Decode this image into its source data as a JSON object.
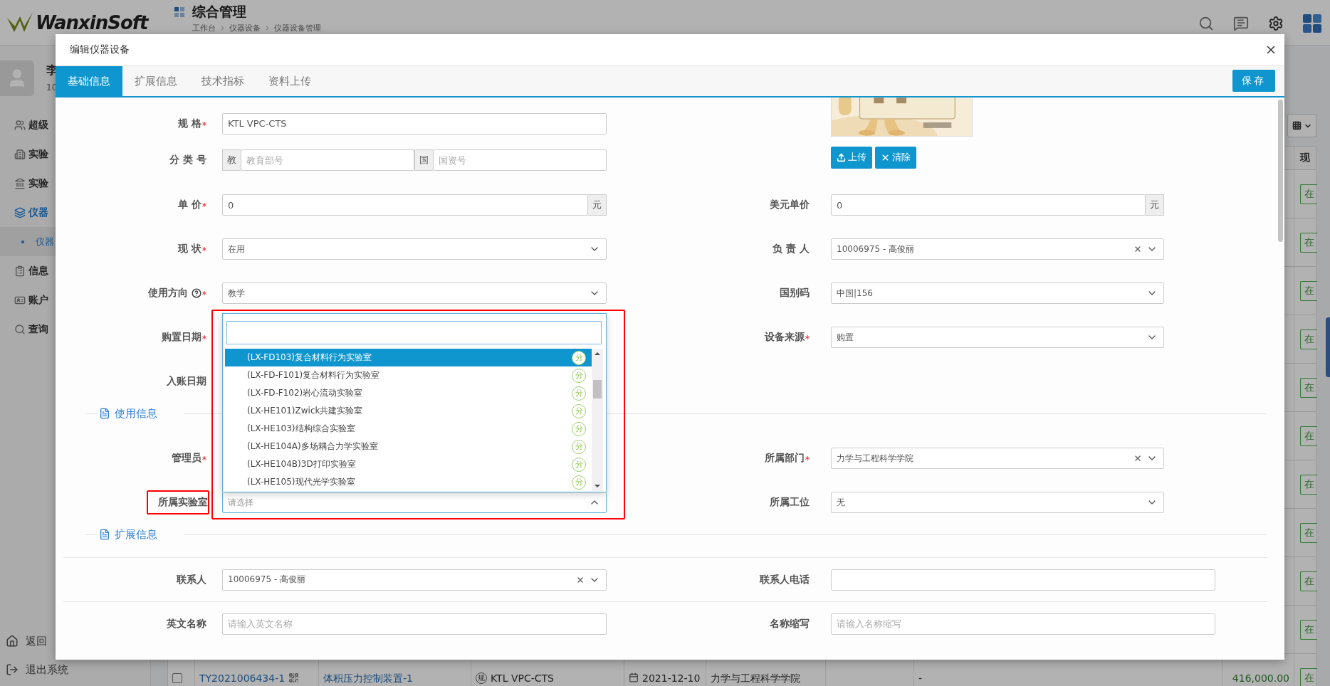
{
  "header": {
    "logo": "WanxinSoft",
    "title": "综合管理",
    "breadcrumb": [
      "工作台",
      "仪器设备",
      "仪器设备管理"
    ]
  },
  "user": {
    "name": "李",
    "id": "10"
  },
  "sidebar": {
    "items": [
      {
        "label": "超级",
        "selected": false
      },
      {
        "label": "实验",
        "selected": false
      },
      {
        "label": "实验",
        "selected": false
      },
      {
        "label": "仪器",
        "selected": true,
        "children": [
          {
            "label": "仪器",
            "selected": true
          }
        ]
      },
      {
        "label": "信息",
        "selected": false
      },
      {
        "label": "账户",
        "selected": false
      },
      {
        "label": "查询",
        "selected": false
      }
    ],
    "footer": [
      "返回",
      "退出系统"
    ]
  },
  "table": {
    "status_header": "现",
    "rows": [
      {
        "status": "在"
      },
      {
        "status": "在"
      },
      {
        "status": "在"
      },
      {
        "status": "在"
      },
      {
        "status": "在"
      },
      {
        "status": "在"
      },
      {
        "status": "在"
      },
      {
        "status": "在"
      },
      {
        "status": "在"
      },
      {
        "status": "在"
      }
    ],
    "last_row": {
      "checked": false,
      "code": "TY2021006434-1",
      "name": "体积压力控制装置-1",
      "model_tag": "规",
      "model": "KTL VPC-CTS",
      "date": "2021-12-10",
      "department": "力学与工程科学学院",
      "column_8": "-",
      "price": "416,000.00",
      "status": "在"
    }
  },
  "modal": {
    "title": "编辑仪器设备",
    "save_button": "保存",
    "tabs": [
      {
        "label": "基础信息",
        "selected": true
      },
      {
        "label": "扩展信息",
        "selected": false
      },
      {
        "label": "技术指标",
        "selected": false
      },
      {
        "label": "资料上传",
        "selected": false
      }
    ],
    "blocks": [
      {
        "kind": "row",
        "left": {
          "label": "规 格",
          "required": true,
          "kind": "input",
          "value": "KTL VPC-CTS"
        }
      },
      {
        "kind": "row",
        "left": {
          "label": "分 类 号",
          "required": false,
          "kind": "group",
          "parts": [
            {
              "addon": "教",
              "placeholder": "教育部号"
            },
            {
              "addon": "国",
              "placeholder": "国资号"
            }
          ]
        },
        "right": {
          "kind": "buttons",
          "buttons": [
            "上传",
            "清除"
          ]
        }
      },
      {
        "kind": "row",
        "left": {
          "label": "单 价",
          "required": true,
          "kind": "input",
          "value": "0",
          "suffix": "元"
        },
        "right": {
          "label": "美元单价",
          "required": false,
          "kind": "input",
          "value": "0",
          "suffix": "元"
        }
      },
      {
        "kind": "row",
        "left": {
          "label": "现 状",
          "required": true,
          "kind": "select",
          "value": "在用"
        },
        "right": {
          "label": "负 责 人",
          "required": false,
          "kind": "select",
          "value": "10006975 - 高俊丽",
          "clearable": true
        }
      },
      {
        "kind": "row",
        "left": {
          "label": "使用方向",
          "help": true,
          "required": true,
          "kind": "select",
          "value": "教学"
        },
        "right": {
          "label": "国别码",
          "required": false,
          "kind": "select",
          "value": "中国|156"
        }
      },
      {
        "kind": "row",
        "left": {
          "label": "购置日期",
          "required": true,
          "kind": "covered"
        },
        "right": {
          "label": "设备来源",
          "required": true,
          "kind": "select",
          "value": "购置"
        }
      },
      {
        "kind": "row",
        "left": {
          "label": "入账日期",
          "required": false,
          "kind": "covered"
        }
      },
      {
        "kind": "section",
        "title": "使用信息"
      },
      {
        "kind": "row",
        "left": {
          "label": "管理员",
          "required": true,
          "kind": "covered"
        },
        "right": {
          "label": "所属部门",
          "required": true,
          "kind": "select",
          "value": "力学与工程科学学院",
          "clearable": true
        }
      },
      {
        "kind": "row",
        "left": {
          "label": "所属实验室",
          "required": false,
          "marked": true,
          "kind": "select",
          "placeholder": "请选择",
          "open": true,
          "options": [
            {
              "label": "(LX-FD103)复合材料行为实验室",
              "tag": "分",
              "selected": true
            },
            {
              "label": "(LX-FD-F101)复合材料行为实验室",
              "tag": "分",
              "selected": false
            },
            {
              "label": "(LX-FD-F102)岩心流动实验室",
              "tag": "分",
              "selected": false
            },
            {
              "label": "(LX-HE101)Zwick共建实验室",
              "tag": "分",
              "selected": false
            },
            {
              "label": "(LX-HE103)结构综合实验室",
              "tag": "分",
              "selected": false
            },
            {
              "label": "(LX-HE104A)多场耦合力学实验室",
              "tag": "分",
              "selected": false
            },
            {
              "label": "(LX-HE104B)3D打印实验室",
              "tag": "分",
              "selected": false
            },
            {
              "label": "(LX-HE105)现代光学实验室",
              "tag": "分",
              "selected": false
            }
          ]
        },
        "right": {
          "label": "所属工位",
          "required": false,
          "kind": "select",
          "value": "无"
        }
      },
      {
        "kind": "section",
        "title": "扩展信息"
      },
      {
        "kind": "row",
        "ruled": true,
        "left": {
          "label": "联系人",
          "required": false,
          "kind": "select",
          "value": "10006975 - 高俊丽",
          "clearable": true
        },
        "right": {
          "label": "联系人电话",
          "required": false,
          "kind": "input",
          "wide": true
        }
      },
      {
        "kind": "row",
        "ruled": true,
        "left": {
          "label": "英文名称",
          "required": false,
          "kind": "input",
          "placeholder": "请输入英文名称"
        },
        "right": {
          "label": "名称缩写",
          "required": false,
          "kind": "input",
          "placeholder": "请输入名称缩写",
          "wide": true
        }
      }
    ]
  }
}
